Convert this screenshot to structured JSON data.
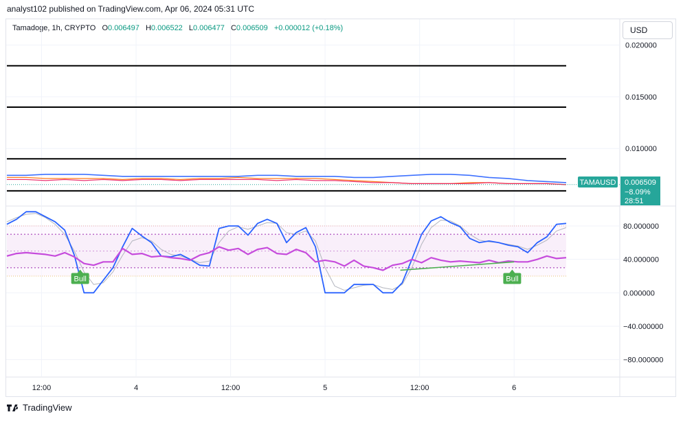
{
  "header": {
    "published_line": "analyst102 published on TradingView.com, Apr 06, 2024 05:31 UTC"
  },
  "legend": {
    "symbol_line": "Tamadoge, 1h, CRYPTO",
    "open_label": "O",
    "open_value": "0.006497",
    "high_label": "H",
    "high_value": "0.006522",
    "low_label": "L",
    "low_value": "0.006477",
    "close_label": "C",
    "close_value": "0.006509",
    "change": "+0.000012 (+0.18%)"
  },
  "currency_button": "USD",
  "price_tag": {
    "symbol": "TAMAUSD",
    "price": "0.006509",
    "change_pct": "−8.09%",
    "countdown": "28:51"
  },
  "footer": {
    "brand": "TradingView"
  },
  "colors": {
    "up": "#089981",
    "price_tag_bg": "#26a69a",
    "stoch_k": "#2962ff",
    "stoch_d_light": "#b2b5be",
    "rsi": "#c64bdc",
    "bull_label": "#4caf50",
    "horizontal_lines": "#000000",
    "rsi_band": "#f3e5f5"
  },
  "chart_data": [
    {
      "type": "line",
      "panel": "price",
      "y_ticks": [
        "0.020000",
        "0.015000",
        "0.010000"
      ],
      "ylim": [
        0.0045,
        0.0225
      ],
      "horizontal_levels": [
        0.018,
        0.014,
        0.009,
        0.0059
      ],
      "x_tick_labels": [
        "12:00",
        "4",
        "12:00",
        "5",
        "12:00",
        "6"
      ],
      "x": [
        0,
        10,
        20,
        30,
        40,
        50,
        60,
        70,
        80,
        90,
        100,
        110,
        120,
        130,
        140,
        150,
        160,
        170,
        180,
        190,
        200,
        210,
        220,
        230,
        240,
        250,
        260,
        270,
        280,
        290
      ],
      "series": [
        {
          "values": [
            0.0074,
            0.0074,
            0.0075,
            0.0075,
            0.0075,
            0.0074,
            0.0073,
            0.0073,
            0.0073,
            0.0073,
            0.0073,
            0.0073,
            0.0073,
            0.0074,
            0.0074,
            0.0073,
            0.0073,
            0.0073,
            0.0072,
            0.0072,
            0.0073,
            0.0074,
            0.0075,
            0.0075,
            0.0074,
            0.0072,
            0.0071,
            0.0069,
            0.0068,
            0.0067
          ]
        },
        {
          "values": [
            0.0072,
            0.0072,
            0.0071,
            0.0071,
            0.0071,
            0.0071,
            0.007,
            0.0071,
            0.0071,
            0.007,
            0.0071,
            0.0071,
            0.0072,
            0.0071,
            0.0071,
            0.0071,
            0.0071,
            0.007,
            0.0069,
            0.0068,
            0.0067,
            0.0066,
            0.0066,
            0.0066,
            0.0067,
            0.0067,
            0.0066,
            0.0066,
            0.0066,
            0.0065
          ]
        },
        {
          "values": [
            0.007,
            0.007,
            0.0069,
            0.007,
            0.0069,
            0.007,
            0.0069,
            0.007,
            0.007,
            0.0069,
            0.007,
            0.007,
            0.007,
            0.007,
            0.0069,
            0.007,
            0.0069,
            0.0069,
            0.0068,
            0.0067,
            0.0067,
            0.0066,
            0.0066,
            0.0066,
            0.0066,
            0.0067,
            0.0066,
            0.0066,
            0.0066,
            0.0065
          ]
        }
      ]
    },
    {
      "type": "line",
      "panel": "oscillator",
      "y_ticks": [
        "80.000000",
        "40.000000",
        "0.000000",
        "−40.000000",
        "−80.000000"
      ],
      "ylim": [
        -100,
        103
      ],
      "bands": [
        80,
        70,
        50,
        30,
        20
      ],
      "x": [
        0,
        5,
        10,
        15,
        20,
        25,
        30,
        35,
        40,
        45,
        50,
        55,
        60,
        65,
        70,
        75,
        80,
        85,
        90,
        95,
        100,
        105,
        110,
        115,
        120,
        125,
        130,
        135,
        140,
        145,
        150,
        155,
        160,
        165,
        170,
        175,
        180,
        185,
        190,
        195,
        200,
        205,
        210,
        215,
        220,
        225,
        230,
        235,
        240,
        245,
        250,
        255,
        260,
        265,
        270,
        275,
        280,
        285,
        290
      ],
      "series": [
        {
          "values": [
            82,
            88,
            97,
            97,
            91,
            85,
            75,
            45,
            0,
            0,
            15,
            30,
            55,
            77,
            68,
            60,
            44,
            43,
            46,
            40,
            33,
            32,
            77,
            80,
            80,
            69,
            83,
            88,
            83,
            60,
            72,
            78,
            55,
            0,
            0,
            0,
            10,
            10,
            10,
            0,
            0,
            12,
            40,
            70,
            86,
            91,
            84,
            79,
            65,
            60,
            62,
            60,
            57,
            55,
            48,
            60,
            67,
            82,
            83
          ]
        },
        {
          "values": [
            85,
            90,
            94,
            95,
            90,
            82,
            70,
            50,
            25,
            10,
            12,
            25,
            45,
            62,
            66,
            62,
            52,
            46,
            44,
            40,
            36,
            38,
            60,
            74,
            79,
            76,
            80,
            84,
            83,
            72,
            70,
            74,
            62,
            30,
            8,
            3,
            6,
            9,
            10,
            6,
            4,
            10,
            30,
            58,
            78,
            87,
            86,
            80,
            70,
            63,
            61,
            60,
            58,
            56,
            52,
            57,
            63,
            74,
            78
          ]
        },
        {
          "values": [
            44,
            47,
            48,
            47,
            46,
            44,
            48,
            43,
            35,
            33,
            37,
            37,
            53,
            46,
            47,
            43,
            44,
            42,
            41,
            39,
            45,
            48,
            55,
            51,
            53,
            46,
            52,
            54,
            47,
            46,
            52,
            48,
            37,
            39,
            37,
            32,
            39,
            32,
            30,
            27,
            33,
            35,
            40,
            36,
            42,
            39,
            37,
            38,
            37,
            36,
            39,
            36,
            38,
            37,
            37,
            40,
            44,
            41,
            42
          ]
        }
      ],
      "divergence_lines": [
        {
          "x": [
            204,
            263
          ],
          "y": [
            27,
            37
          ]
        }
      ],
      "annotations": [
        {
          "label": "Bull",
          "x": 38
        },
        {
          "label": "Bull",
          "x": 262
        }
      ]
    }
  ]
}
